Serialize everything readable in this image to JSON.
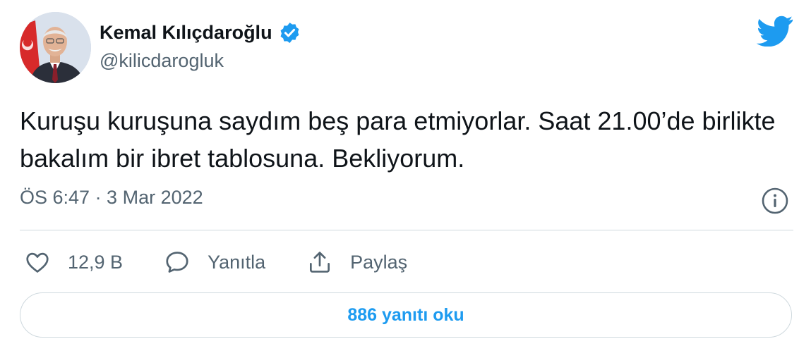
{
  "author": {
    "display_name": "Kemal Kılıçdaroğlu",
    "handle": "@kilicdarogluk",
    "verified": true,
    "avatar": "profile-photo"
  },
  "brand": {
    "icon": "twitter-bird-icon",
    "color": "#1d9bf0"
  },
  "tweet": {
    "text": "Kuruşu kuruşuna saydım beş para etmiyorlar. Saat 21.00’de birlikte bakalım bir ibret tablosuna. Bekliyorum.",
    "timestamp": "ÖS 6:47 · 3 Mar 2022"
  },
  "actions": {
    "like_count": "12,9 B",
    "reply_label": "Yanıtla",
    "share_label": "Paylaş"
  },
  "replies": {
    "button_label": "886 yanıtı oku"
  },
  "colors": {
    "text_primary": "#0f1419",
    "text_secondary": "#536471",
    "accent": "#1d9bf0",
    "border": "#cfd9de"
  }
}
